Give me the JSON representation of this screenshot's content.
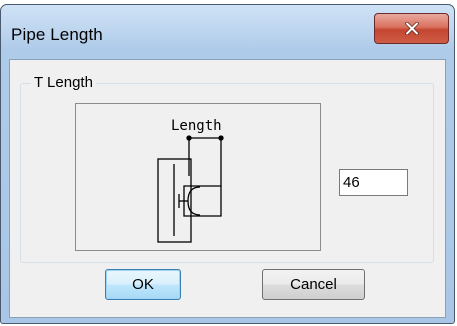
{
  "window": {
    "title": "Pipe Length",
    "close_glyph": "X"
  },
  "group": {
    "label": "T Length"
  },
  "diagram": {
    "length_label": "Length"
  },
  "length_field": {
    "value": "46"
  },
  "buttons": {
    "ok_label": "OK",
    "cancel_label": "Cancel"
  },
  "icons": {
    "close": "close-icon"
  },
  "colors": {
    "titlebar": "#bcd4ee",
    "close_button": "#c4452f",
    "client_bg": "#f0f0f0",
    "default_button_border": "#3c7fb1"
  }
}
